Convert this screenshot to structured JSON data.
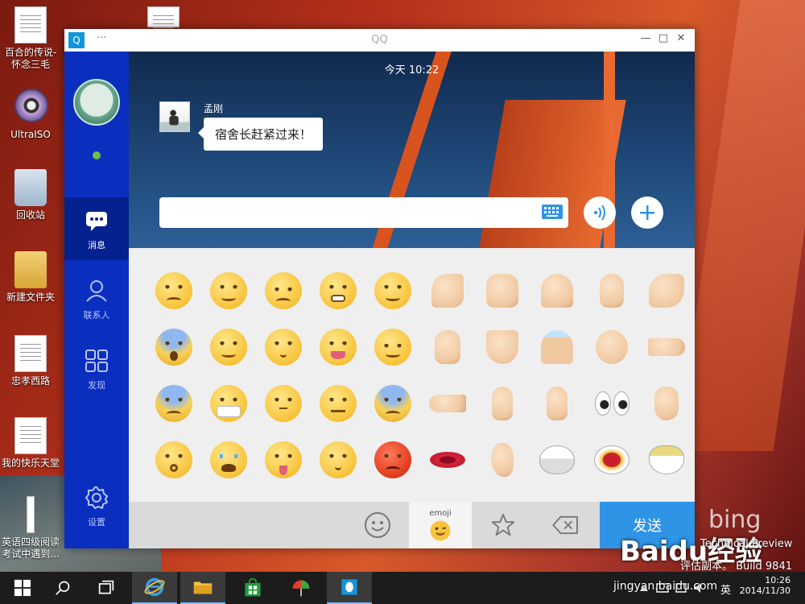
{
  "desktop": {
    "icons": [
      {
        "label": "百合的传说-怀念三毛",
        "icon": "document-icon"
      },
      {
        "label": "UltraISO",
        "icon": "disc-icon"
      },
      {
        "label": "回收站",
        "icon": "recycle-bin-icon"
      },
      {
        "label": "新建文件夹",
        "icon": "folder-icon"
      },
      {
        "label": "忠孝西路",
        "icon": "document-icon"
      },
      {
        "label": "我的快乐天堂",
        "icon": "document-icon"
      },
      {
        "label": "英语四级阅读考试中遇到...",
        "icon": "document-icon"
      }
    ],
    "watermark": {
      "bing": "bing",
      "baidu": "Baidu经验",
      "site": "jingyan.baidu.com",
      "tech_preview": "Technical Preview",
      "build": "评估副本。 Build 9841"
    }
  },
  "window": {
    "title": "QQ",
    "menu_dots": "···",
    "controls": {
      "minimize": "—",
      "maximize": "□",
      "close": "✕"
    }
  },
  "sidebar": {
    "items": [
      {
        "label": "消息",
        "icon": "chat-bubble-icon",
        "active": true
      },
      {
        "label": "联系人",
        "icon": "person-icon",
        "active": false
      },
      {
        "label": "发现",
        "icon": "grid-icon",
        "active": false
      },
      {
        "label": "设置",
        "icon": "gear-icon",
        "active": false
      }
    ]
  },
  "chat": {
    "time": "今天 10:22",
    "sender": "孟刚",
    "message": "宿舍长赶紧过来！",
    "input_value": ""
  },
  "emoji_tabs": [
    {
      "name": "smiley-tab",
      "label": "",
      "active": false
    },
    {
      "name": "emoji-tab",
      "label": "emoji",
      "active": true
    },
    {
      "name": "favorites-tab",
      "label": "",
      "active": false
    },
    {
      "name": "backspace-tab",
      "label": "",
      "active": false
    }
  ],
  "send_label": "发送",
  "taskbar": {
    "time": "10:26",
    "date": "2014/11/30",
    "ime": "英"
  },
  "colors": {
    "sidebar": "#0a2fbf",
    "sidebar_active": "#042190",
    "send": "#2f93e6"
  }
}
